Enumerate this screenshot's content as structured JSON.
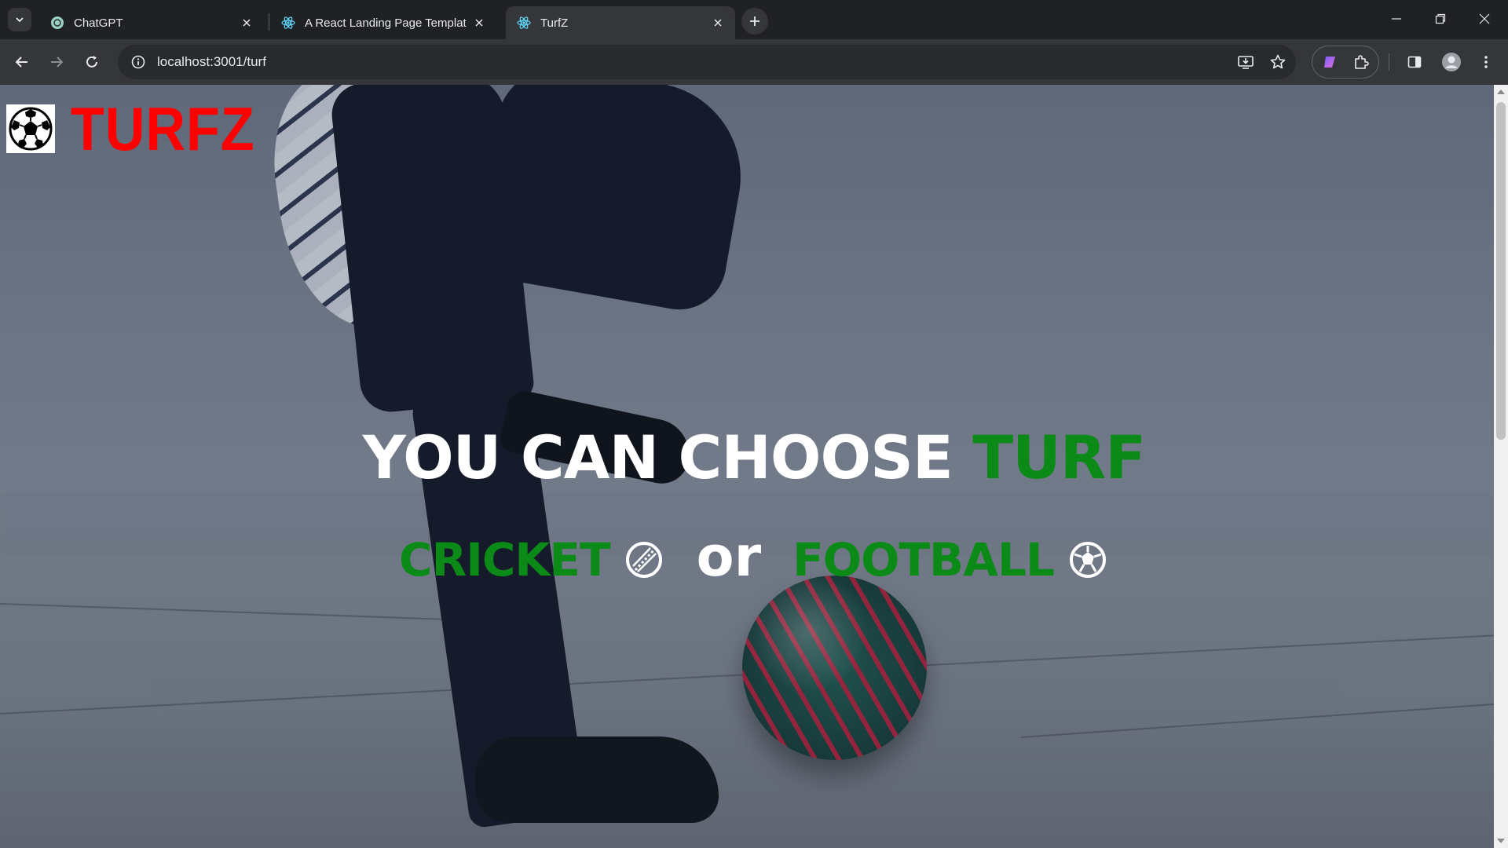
{
  "browser": {
    "tabs": [
      {
        "title": "ChatGPT",
        "favicon": "chatgpt-icon",
        "active": false
      },
      {
        "title": "A React Landing Page Templat",
        "favicon": "react-icon",
        "active": false
      },
      {
        "title": "TurfZ",
        "favicon": "react-icon",
        "active": true
      }
    ],
    "url": "localhost:3001/turf"
  },
  "page": {
    "logo_text": "TURFZ",
    "hero_title_main": "YOU CAN CHOOSE",
    "hero_title_accent": "TURF",
    "choice_cricket": "CRICKET",
    "choice_or": "or",
    "choice_football": "FOOTBALL"
  },
  "colors": {
    "logo": "#ff0000",
    "accent_green": "#0b8a17",
    "hero_text": "#ffffff"
  }
}
